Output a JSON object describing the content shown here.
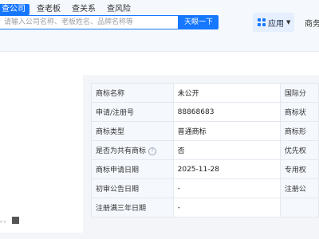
{
  "search": {
    "tabs": [
      "查公司",
      "查老板",
      "查关系",
      "查风险"
    ],
    "placeholder": "请输入公司名称、老板姓名、品牌名称等",
    "button": "天眼一下"
  },
  "header": {
    "app_label": "应用",
    "next_label": "商务"
  },
  "left": {
    "caption": "。。"
  },
  "info_table": {
    "rows": [
      {
        "label": "商标名称",
        "value": "未公开",
        "right_label": "国际分"
      },
      {
        "label": "申请/注册号",
        "value": "88868683",
        "right_label": "商标状"
      },
      {
        "label": "商标类型",
        "value": "普通商标",
        "right_label": "商标形"
      },
      {
        "label": "是否为共有商标",
        "value": "否",
        "right_label": "优先权"
      },
      {
        "label": "商标申请日期",
        "value": "2025-11-28",
        "right_label": "专用权"
      },
      {
        "label": "初审公告日期",
        "value": "-",
        "right_label": "注册公"
      },
      {
        "label": "注册满三年日期",
        "value": "-",
        "right_label": ""
      }
    ]
  },
  "colors": {
    "accent": "#1677ff",
    "label_bg": "#f5f8fd",
    "page_bg": "#f3f5f8"
  }
}
